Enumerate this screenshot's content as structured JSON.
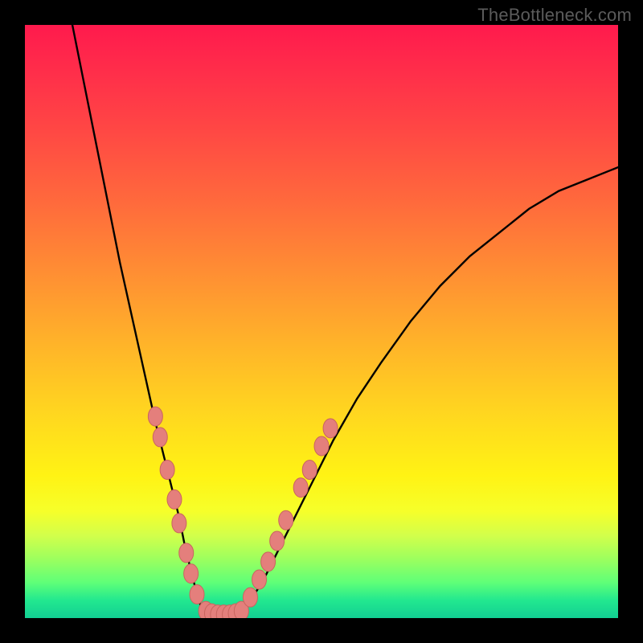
{
  "watermark": "TheBottleneck.com",
  "colors": {
    "frame": "#000000",
    "curve": "#000000",
    "marker_fill": "#e47f7c",
    "marker_stroke": "#c9655f",
    "gradient_stops": [
      "#ff1a4d",
      "#ff2e4a",
      "#ff4844",
      "#ff6a3c",
      "#ff8f33",
      "#ffb429",
      "#ffd81f",
      "#fff314",
      "#f6ff2a",
      "#d3ff4a",
      "#9dff5e",
      "#5fff78",
      "#22e88f",
      "#12cf93"
    ]
  },
  "chart_data": {
    "type": "line",
    "title": "",
    "xlabel": "",
    "ylabel": "",
    "xlim": [
      0,
      100
    ],
    "ylim": [
      0,
      100
    ],
    "note": "Axes are unlabeled in the source image; x/y are normalized 0–100 over the visible plot area. y=0 at bottom (green), y=100 at top (red).",
    "series": [
      {
        "name": "curve-left",
        "x": [
          8,
          10,
          12,
          14,
          16,
          18,
          20,
          22,
          24,
          26,
          27,
          28,
          29,
          30
        ],
        "y": [
          100,
          90,
          80,
          70,
          60,
          51,
          42,
          33,
          25,
          17,
          12,
          8,
          4,
          1
        ]
      },
      {
        "name": "curve-bottom",
        "x": [
          30,
          31,
          32,
          33,
          34,
          35,
          36,
          37
        ],
        "y": [
          1,
          0.5,
          0.3,
          0.3,
          0.3,
          0.5,
          0.8,
          1.5
        ]
      },
      {
        "name": "curve-right",
        "x": [
          37,
          40,
          44,
          48,
          52,
          56,
          60,
          65,
          70,
          75,
          80,
          85,
          90,
          95,
          100
        ],
        "y": [
          1.5,
          6,
          14,
          22,
          30,
          37,
          43,
          50,
          56,
          61,
          65,
          69,
          72,
          74,
          76
        ]
      }
    ],
    "markers": [
      {
        "x": 22.0,
        "y": 34.0
      },
      {
        "x": 22.8,
        "y": 30.5
      },
      {
        "x": 24.0,
        "y": 25.0
      },
      {
        "x": 25.2,
        "y": 20.0
      },
      {
        "x": 26.0,
        "y": 16.0
      },
      {
        "x": 27.2,
        "y": 11.0
      },
      {
        "x": 28.0,
        "y": 7.5
      },
      {
        "x": 29.0,
        "y": 4.0
      },
      {
        "x": 30.5,
        "y": 1.2
      },
      {
        "x": 31.5,
        "y": 0.8
      },
      {
        "x": 32.5,
        "y": 0.6
      },
      {
        "x": 33.5,
        "y": 0.6
      },
      {
        "x": 34.5,
        "y": 0.6
      },
      {
        "x": 35.5,
        "y": 0.8
      },
      {
        "x": 36.5,
        "y": 1.2
      },
      {
        "x": 38.0,
        "y": 3.5
      },
      {
        "x": 39.5,
        "y": 6.5
      },
      {
        "x": 41.0,
        "y": 9.5
      },
      {
        "x": 42.5,
        "y": 13.0
      },
      {
        "x": 44.0,
        "y": 16.5
      },
      {
        "x": 46.5,
        "y": 22.0
      },
      {
        "x": 48.0,
        "y": 25.0
      },
      {
        "x": 50.0,
        "y": 29.0
      },
      {
        "x": 51.5,
        "y": 32.0
      }
    ]
  }
}
